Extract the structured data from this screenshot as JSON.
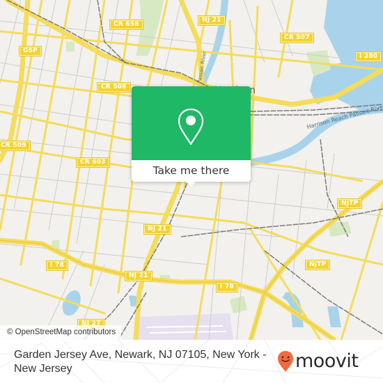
{
  "map": {
    "colors": {
      "land": "#f2f1ee",
      "water": "#a9d3ea",
      "park": "#d6e9c2",
      "major_road": "#f5dc5a",
      "minor_road": "#c9c6c0",
      "rail": "#777777",
      "airport": "#e6dff0"
    },
    "route_shields": [
      {
        "id": "cr658",
        "label": "CR 658"
      },
      {
        "id": "nj21-top",
        "label": "NJ 21"
      },
      {
        "id": "cr507",
        "label": "CR 507"
      },
      {
        "id": "gsp",
        "label": "GSP"
      },
      {
        "id": "i280",
        "label": "I 280"
      },
      {
        "id": "cr508",
        "label": "CR 508"
      },
      {
        "id": "cr509",
        "label": "CR 509"
      },
      {
        "id": "cr603",
        "label": "CR 603"
      },
      {
        "id": "njtp-upper",
        "label": "NJTP"
      },
      {
        "id": "nj21-mid",
        "label": "NJ 21"
      },
      {
        "id": "njtp-lower",
        "label": "NJTP"
      },
      {
        "id": "i78-left",
        "label": "I 78"
      },
      {
        "id": "nj21-lower",
        "label": "NJ 21"
      },
      {
        "id": "i78-right",
        "label": "I 78"
      },
      {
        "id": "nj27",
        "label": "NJ 27"
      }
    ],
    "place_labels": [
      {
        "id": "harrison",
        "label": "Harrison"
      }
    ],
    "water_labels": [
      {
        "id": "passaic-river-reach",
        "label": "Harrison Reach Passaic River"
      },
      {
        "id": "passaic-river-north",
        "label": "Passaic River"
      }
    ],
    "attribution": "© OpenStreetMap contributors"
  },
  "popup": {
    "icon": "map-pin-icon",
    "button_label": "Take me there",
    "accent_color": "#1fb866"
  },
  "footer": {
    "address": "Garden Jersey Ave, Newark, NJ 07105, New York - New Jersey",
    "brand": {
      "name": "moovit",
      "logo_icon": "moovit-pin-icon",
      "logo_color": "#f26a3d"
    }
  }
}
